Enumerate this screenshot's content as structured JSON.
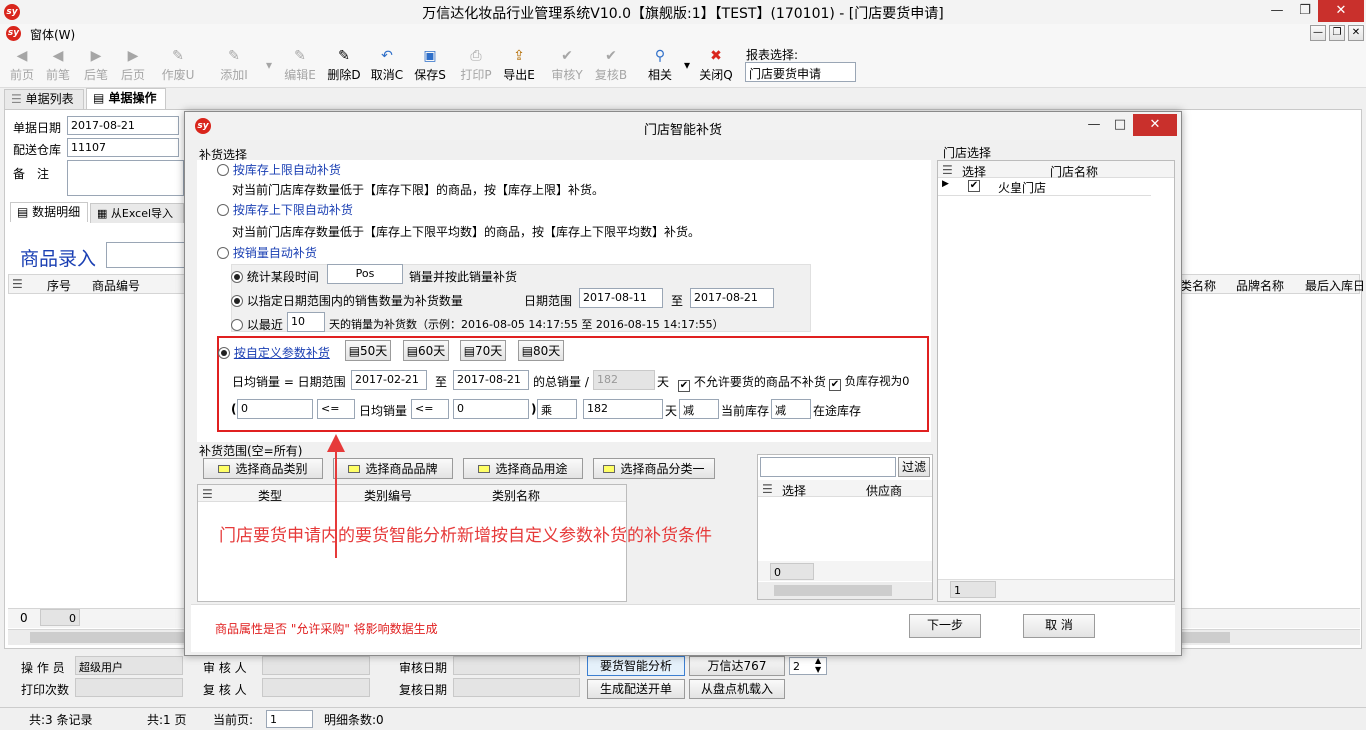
{
  "window": {
    "title": "万信达化妆品行业管理系统V10.0【旗舰版:1】【TEST】(170101) - [门店要货申请]",
    "logo": "sy",
    "min": "—",
    "restore": "❐",
    "close": "✕"
  },
  "menu": {
    "window": "窗体(W)",
    "mdi_min": "—",
    "mdi_restore": "❐",
    "mdi_close": "✕"
  },
  "toolbar": {
    "items": [
      {
        "label": "前页",
        "icon": "◀"
      },
      {
        "label": "前笔",
        "icon": "◀"
      },
      {
        "label": "后笔",
        "icon": "▶"
      },
      {
        "label": "后页",
        "icon": "▶"
      },
      {
        "label": "作废U",
        "icon": "✎"
      },
      {
        "label": "添加I",
        "icon": "✎"
      },
      {
        "label": "编辑E",
        "icon": "✎"
      },
      {
        "label": "删除D",
        "icon": "✎"
      },
      {
        "label": "取消C",
        "icon": "↶"
      },
      {
        "label": "保存S",
        "icon": "▣"
      },
      {
        "label": "打印P",
        "icon": "⎙"
      },
      {
        "label": "导出E",
        "icon": "⇪"
      },
      {
        "label": "审核Y",
        "icon": "✔"
      },
      {
        "label": "复核B",
        "icon": "✔"
      },
      {
        "label": "相关",
        "icon": "⚲"
      },
      {
        "label": "关闭Q",
        "icon": "✖"
      }
    ],
    "dropdown_arrow": "▾",
    "report_label": "报表选择:",
    "report_value": "门店要货申请"
  },
  "main_tabs": [
    {
      "label": "单据列表",
      "icon": "☰"
    },
    {
      "label": "单据操作",
      "icon": "▤"
    }
  ],
  "form": {
    "date_label": "单据日期",
    "date_value": "2017-08-21",
    "warehouse_label": "配送仓库",
    "warehouse_value": "11107",
    "remark_label": "备　注"
  },
  "sub_tabs": [
    {
      "label": "数据明细",
      "icon": "▤"
    },
    {
      "label": "从Excel导入",
      "icon": "▦"
    }
  ],
  "entry": {
    "label": "商品录入"
  },
  "grid": {
    "columns": [
      "序号",
      "商品编号"
    ],
    "right_columns": [
      "类名称",
      "品牌名称",
      "最后入库日"
    ],
    "footer_values": [
      "0",
      "0"
    ]
  },
  "bottom": {
    "operator_label": "操 作 员",
    "operator_value": "超级用户",
    "print_label": "打印次数",
    "reviewer_label": "审 核 人",
    "checker_label": "复 核 人",
    "review_date_label": "审核日期",
    "check_date_label": "复核日期",
    "btn_analysis": "要货智能分析",
    "btn_wxd": "万信达767",
    "spin_value": "2",
    "btn_gen": "生成配送开单",
    "btn_load": "从盘点机载入"
  },
  "status": {
    "records": "共:3 条记录",
    "pages": "共:1 页",
    "current_label": "当前页:",
    "current_value": "1",
    "detail": "明细条数:0"
  },
  "dialog": {
    "title": "门店智能补货",
    "ctrl": {
      "min": "—",
      "max": "□",
      "close": "✕"
    },
    "group_title": "补货选择",
    "opt1": {
      "label": "按库存上限自动补货",
      "desc": "对当前门店库存数量低于【库存下限】的商品，按【库存上限】补货。"
    },
    "opt2": {
      "label": "按库存上下限自动补货",
      "desc": "对当前门店库存数量低于【库存上下限平均数】的商品，按【库存上下限平均数】补货。"
    },
    "opt3": {
      "label": "按销量自动补货",
      "sub1": {
        "label": "统计某段时间",
        "value": "Pos",
        "suffix": "销量并按此销量补货"
      },
      "sub2": {
        "label": "以指定日期范围内的销售数量为补货数量",
        "range_label": "日期范围",
        "from": "2017-08-11",
        "to_label": "至",
        "to": "2017-08-21"
      },
      "sub3": {
        "label": "以最近",
        "value": "10",
        "suffix": "天的销量为补货数（示例：2016-08-05 14:17:55 至 2016-08-15 14:17:55）"
      }
    },
    "opt4": {
      "label": "按自定义参数补货",
      "days": [
        "50天",
        "60天",
        "70天",
        "80天"
      ],
      "row1": {
        "prefix": "日均销量 = 日期范围",
        "from": "2017-02-21",
        "to_label": "至",
        "to": "2017-08-21",
        "total_label": "的总销量 /",
        "days_value": "182",
        "days_unit": "天",
        "chk1": "不允许要货的商品不补货",
        "chk2": "负库存视为0"
      },
      "row2": {
        "open": "(",
        "v1": "0",
        "op1": "<=",
        "mid": "日均销量",
        "op2": "<=",
        "v2": "0",
        "close": ")",
        "mul": "乘",
        "mul_value": "182",
        "day_unit": "天",
        "minus1": "减",
        "stock_label": "当前库存",
        "minus2": "减",
        "transit_label": "在途库存"
      }
    },
    "scope_title": "补货范围(空=所有)",
    "scope_buttons": [
      "选择商品类别",
      "选择商品品牌",
      "选择商品用途",
      "选择商品分类一"
    ],
    "scope_columns": [
      "类型",
      "类别编号",
      "类别名称"
    ],
    "filter_btn": "过滤",
    "supplier_columns": [
      "选择",
      "供应商"
    ],
    "supplier_footer": "0",
    "store_title": "门店选择",
    "store_columns": [
      "选择",
      "门店名称"
    ],
    "store_rows": [
      {
        "name": "火皇门店",
        "checked": true
      }
    ],
    "store_footer": "1",
    "annotation": "门店要货申请内的要货智能分析新增按自定义参数补货的补货条件",
    "note": "商品属性是否 \"允许采购\" 将影响数据生成",
    "next": "下一步",
    "cancel": "取 消"
  },
  "colors": {
    "accent_red": "#e63a3a",
    "link_blue": "#1a3fb3",
    "highlight_red": "#e02020"
  }
}
